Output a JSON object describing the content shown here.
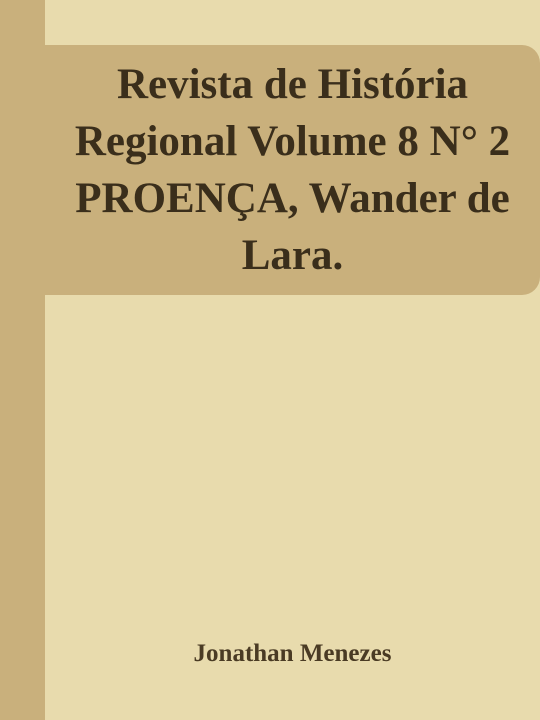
{
  "cover": {
    "title": "Revista de História Regional Volume 8 N° 2 PROENÇA, Wander de Lara.",
    "author": "Jonathan Menezes"
  },
  "colors": {
    "background": "#e8dbad",
    "accent": "#c9b07c",
    "title_text": "#3a2e1b",
    "author_text": "#4a3b24"
  }
}
